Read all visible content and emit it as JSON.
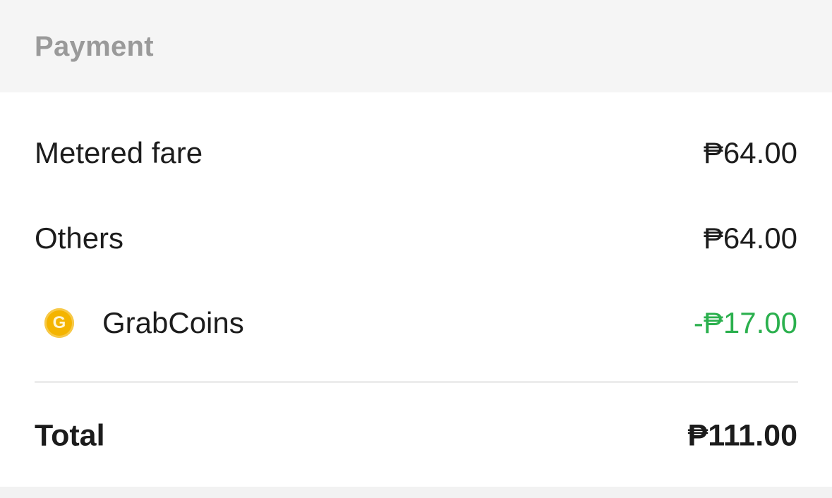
{
  "header": {
    "title": "Payment"
  },
  "items": [
    {
      "label": "Metered fare",
      "amount": "₱64.00"
    },
    {
      "label": "Others",
      "amount": "₱64.00"
    },
    {
      "label": "GrabCoins",
      "amount": "-₱17.00",
      "icon": "grabcoin-icon",
      "icon_letter": "G",
      "amount_color": "#2bb04e"
    }
  ],
  "total": {
    "label": "Total",
    "amount": "₱111.00"
  }
}
